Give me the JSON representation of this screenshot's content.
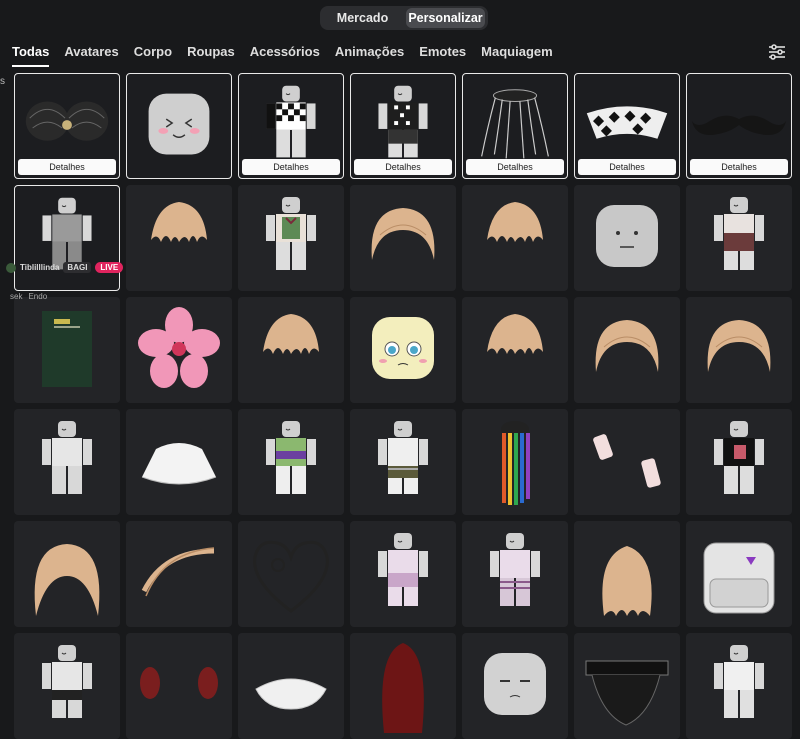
{
  "mode": {
    "items": [
      {
        "label": "Mercado"
      },
      {
        "label": "Personalizar"
      }
    ],
    "active": 1
  },
  "tabs": [
    {
      "label": "Todas"
    },
    {
      "label": "Avatares"
    },
    {
      "label": "Corpo"
    },
    {
      "label": "Roupas"
    },
    {
      "label": "Acessórios"
    },
    {
      "label": "Animações"
    },
    {
      "label": "Emotes"
    },
    {
      "label": "Maquiagem"
    }
  ],
  "active_tab": 0,
  "details_label": "Detalhes",
  "overlay": {
    "streamer": "Tiblilllinda",
    "tag": "BAGI",
    "live": "LIVE",
    "sub1": "sek",
    "sub2": "Endo"
  },
  "left_edge_char": "s",
  "colors": {
    "background": "#18191b",
    "tile": "#232427",
    "selected_border": "#e9e9e9",
    "live": "#e0245e"
  },
  "items": [
    {
      "name": "black-wings-hat-icon",
      "selected": true,
      "details": true
    },
    {
      "name": "blush-face-head-icon",
      "selected": true,
      "details": false
    },
    {
      "name": "checkered-outfit-avatar-icon",
      "selected": true,
      "details": true
    },
    {
      "name": "black-checkered-outfit-avatar-icon",
      "selected": true,
      "details": true
    },
    {
      "name": "chain-crown-accessory-icon",
      "selected": true,
      "details": true
    },
    {
      "name": "checkered-collar-accessory-icon",
      "selected": true,
      "details": true
    },
    {
      "name": "mustache-accessory-icon",
      "selected": true,
      "details": true
    },
    {
      "name": "gray-pose-avatar-icon",
      "selected": true,
      "details": false
    },
    {
      "name": "blonde-messy-hair-icon",
      "selected": false,
      "details": false
    },
    {
      "name": "green-shirt-avatar-icon",
      "selected": false,
      "details": false
    },
    {
      "name": "blonde-bob-hair-icon",
      "selected": false,
      "details": false
    },
    {
      "name": "blonde-fluffy-hair-icon",
      "selected": false,
      "details": false
    },
    {
      "name": "neutral-face-head-icon",
      "selected": false,
      "details": false
    },
    {
      "name": "brown-top-avatar-icon",
      "selected": false,
      "details": false
    },
    {
      "name": "green-book-accessory-icon",
      "selected": false,
      "details": false
    },
    {
      "name": "pink-flower-accessory-icon",
      "selected": false,
      "details": false
    },
    {
      "name": "blonde-curly-hair-icon",
      "selected": false,
      "details": false
    },
    {
      "name": "yellow-scared-head-icon",
      "selected": false,
      "details": false
    },
    {
      "name": "blonde-tuft-hair-icon",
      "selected": false,
      "details": false
    },
    {
      "name": "blonde-shaggy-hair-icon",
      "selected": false,
      "details": false
    },
    {
      "name": "blonde-long-bob-hair-icon",
      "selected": false,
      "details": false
    },
    {
      "name": "white-plain-avatar-icon",
      "selected": false,
      "details": false
    },
    {
      "name": "white-capelet-accessory-icon",
      "selected": false,
      "details": false
    },
    {
      "name": "green-jacket-avatar-icon",
      "selected": false,
      "details": false
    },
    {
      "name": "striped-skirt-avatar-icon",
      "selected": false,
      "details": false
    },
    {
      "name": "rainbow-braids-hair-icon",
      "selected": false,
      "details": false
    },
    {
      "name": "lace-gloves-accessory-icon",
      "selected": false,
      "details": false
    },
    {
      "name": "black-dress-avatar-icon",
      "selected": false,
      "details": false
    },
    {
      "name": "blonde-bangs-hair-icon",
      "selected": false,
      "details": false
    },
    {
      "name": "blonde-side-part-hair-icon",
      "selected": false,
      "details": false
    },
    {
      "name": "music-heart-clef-icon",
      "selected": false,
      "details": false
    },
    {
      "name": "pink-skirt-avatar-icon",
      "selected": false,
      "details": false
    },
    {
      "name": "pink-striped-avatar-icon",
      "selected": false,
      "details": false
    },
    {
      "name": "blonde-wavy-hair-icon",
      "selected": false,
      "details": false
    },
    {
      "name": "white-backpack-accessory-icon",
      "selected": false,
      "details": false
    },
    {
      "name": "white-black-shorts-avatar-icon",
      "selected": false,
      "details": false
    },
    {
      "name": "red-pigtails-hair-icon",
      "selected": false,
      "details": false
    },
    {
      "name": "white-scarf-accessory-icon",
      "selected": false,
      "details": false
    },
    {
      "name": "red-long-hair-icon",
      "selected": false,
      "details": false
    },
    {
      "name": "sleepy-face-head-icon",
      "selected": false,
      "details": false
    },
    {
      "name": "black-lace-belt-accessory-icon",
      "selected": false,
      "details": false
    },
    {
      "name": "white-shirt-avatar-icon",
      "selected": false,
      "details": false
    }
  ]
}
